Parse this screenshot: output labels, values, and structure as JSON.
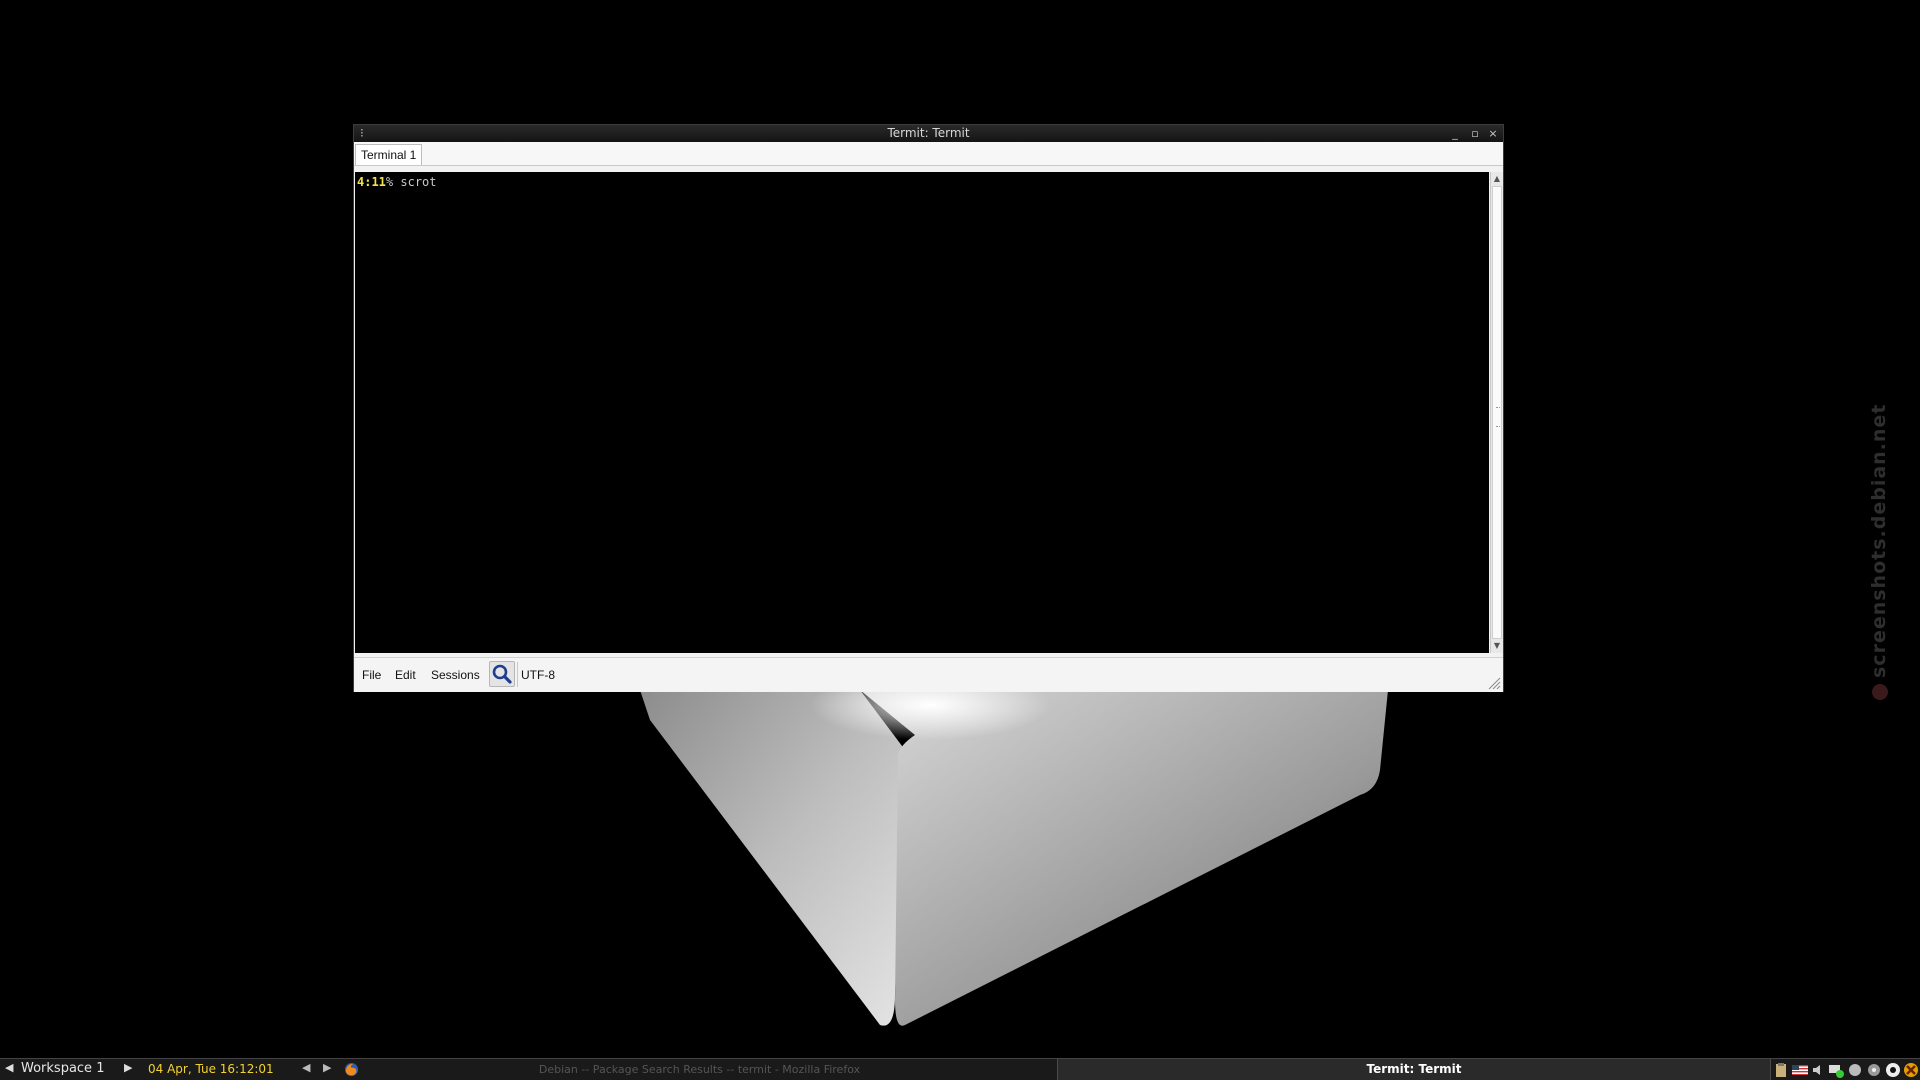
{
  "window": {
    "title": "Termit: Termit",
    "controls": {
      "minimize": "_",
      "maximize": "▫",
      "close": "×"
    },
    "tabs": [
      {
        "label": "Terminal 1",
        "active": true
      }
    ],
    "terminal": {
      "prompt_time": "4:11",
      "prompt_symbol": "%",
      "command": "scrot"
    },
    "statusbar": {
      "menus": [
        "File",
        "Edit",
        "Sessions"
      ],
      "encoding": "UTF-8"
    }
  },
  "taskbar": {
    "workspace": "Workspace 1",
    "clock": "04 Apr, Tue 16:12:01",
    "tasks": [
      {
        "label": "Debian -- Package Search Results -- termit - Mozilla Firefox",
        "active": false
      },
      {
        "label": "Termit: Termit",
        "active": true
      }
    ]
  },
  "watermark": "screenshots.debian.net",
  "icons": [
    "menu-dots-icon",
    "minimize-icon",
    "maximize-icon",
    "close-icon",
    "search-icon",
    "resize-grip-icon",
    "firefox-icon",
    "tray-icons"
  ],
  "colors": {
    "prompt_time": "#f2e34a",
    "clock": "#f3d22f",
    "terminal_bg": "#000000",
    "desktop_bg": "#000000"
  }
}
